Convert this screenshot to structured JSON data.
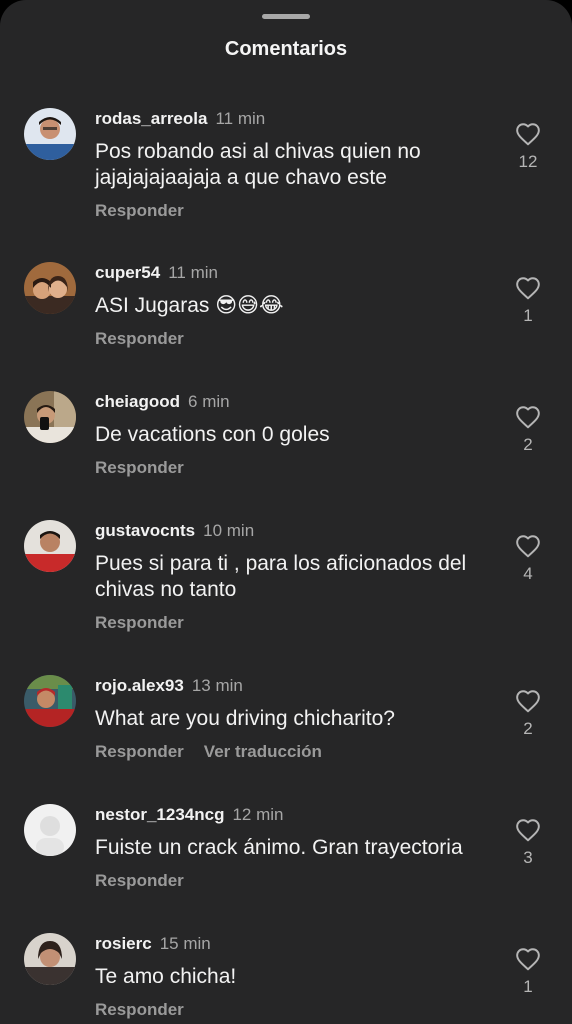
{
  "sheet": {
    "title": "Comentarios"
  },
  "comments": [
    {
      "user": "rodas_arreola",
      "time": "11 min",
      "text": "Pos robando asi al chivas quien no jajajajajaajaja a que chavo este",
      "reply": "Responder",
      "likes": "12"
    },
    {
      "user": "cuper54",
      "time": "11 min",
      "text": "ASI Jugaras 😎😅😂",
      "reply": "Responder",
      "likes": "1"
    },
    {
      "user": "cheiagood",
      "time": "6 min",
      "text": "De vacations con 0 goles",
      "reply": "Responder",
      "likes": "2"
    },
    {
      "user": "gustavocnts",
      "time": "10 min",
      "text": "Pues si para ti , para los aficionados del chivas no tanto",
      "reply": "Responder",
      "likes": "4"
    },
    {
      "user": "rojo.alex93",
      "time": "13 min",
      "text": "What are you driving chicharito?",
      "reply": "Responder",
      "translate": "Ver traducción",
      "likes": "2"
    },
    {
      "user": "nestor_1234ncg",
      "time": "12 min",
      "text": "Fuiste un crack ánimo. Gran trayectoria",
      "reply": "Responder",
      "likes": "3"
    },
    {
      "user": "rosierc",
      "time": "15 min",
      "text": "Te amo chicha!",
      "reply": "Responder",
      "likes": "1"
    }
  ],
  "icons": {
    "like": "heart-outline-icon",
    "handle": "drag-handle"
  },
  "colors": {
    "background": "#262627",
    "text": "#f2f2f2",
    "muted": "#9a9a9a"
  }
}
